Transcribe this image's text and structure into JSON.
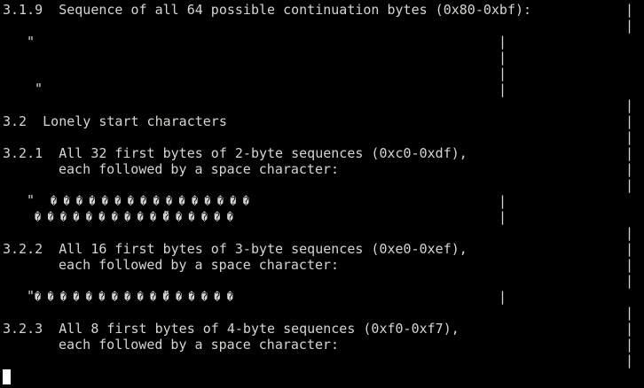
{
  "terminal": {
    "lines": {
      "h319": "3.1.9  Sequence of all 64 possible continuation bytes (0x80-0xbf):",
      "q_open": "\"",
      "q_close": "\"",
      "h32": "3.2  Lonely start characters",
      "h321_a": "3.2.1  All 32 first bytes of 2-byte sequences (0xc0-0xdf),",
      "h321_b": "each followed by a space character:",
      "s2_row1_quote": "\"",
      "s2_row1_glyphs": "� � � � � � � � � � � � � � � �",
      "s2_row2_glyphs": "� � � � � � � � � � � � � � � �",
      "s2_row2_quote": "\"",
      "h322_a": "3.2.2  All 16 first bytes of 3-byte sequences (0xe0-0xef),",
      "h322_b": "each followed by a space character:",
      "s3_quote_open": "\"",
      "s3_glyphs": "� � � � � � � � � � � � � � � �",
      "s3_quote_close": "\"",
      "h323_a": "3.2.3  All 8 first bytes of 4-byte sequences (0xf0-0xf7),",
      "h323_b": "each followed by a space character:"
    },
    "bar_char": "|",
    "colors": {
      "background": "#000000",
      "foreground": "#d3d7cf",
      "cursor": "#ffffff"
    }
  }
}
